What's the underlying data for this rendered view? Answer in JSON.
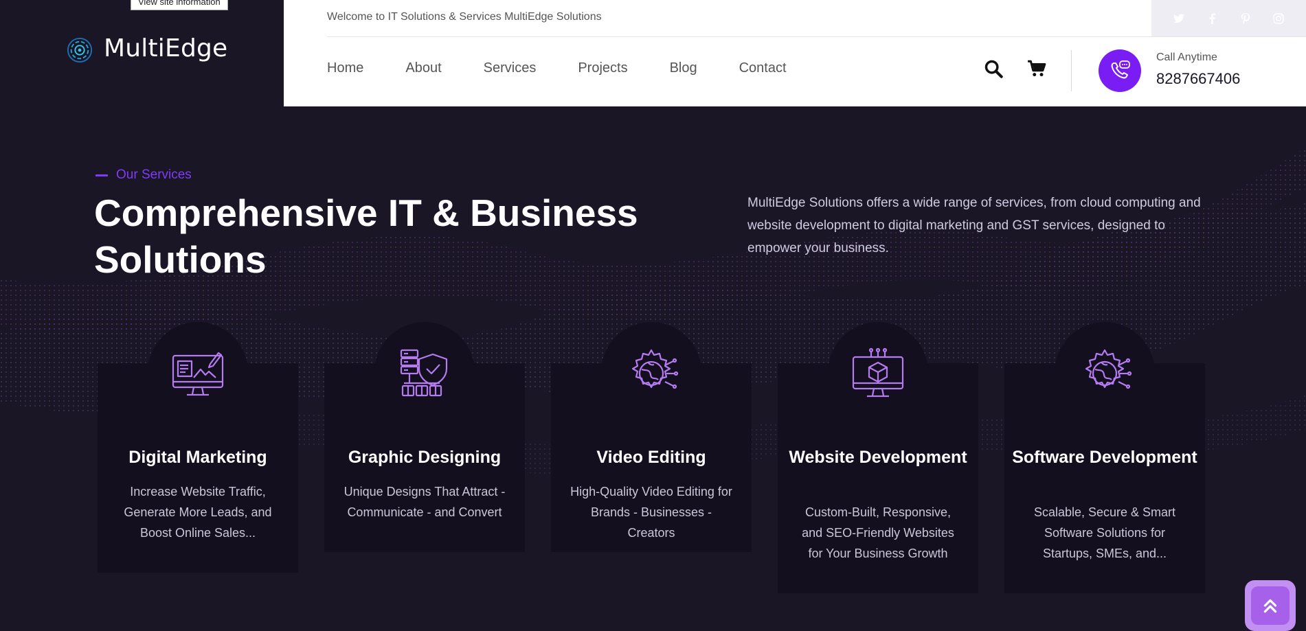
{
  "tooltip": "View site information",
  "brand": {
    "name": "MultiEdge"
  },
  "header": {
    "welcome": "Welcome to IT Solutions & Services MultiEdge Solutions",
    "nav": [
      "Home",
      "About",
      "Services",
      "Projects",
      "Blog",
      "Contact"
    ],
    "call_label": "Call Anytime",
    "call_number": "8287667406",
    "social_icons": [
      "twitter-icon",
      "facebook-icon",
      "pinterest-icon",
      "instagram-icon"
    ]
  },
  "section": {
    "eyebrow": "Our Services",
    "title": "Comprehensive IT & Business Solutions",
    "intro": "MultiEdge Solutions offers a wide range of services, from cloud computing and website development to digital marketing and GST services, designed to empower your business."
  },
  "cards": [
    {
      "title": "Digital Marketing",
      "desc": "Increase Website Traffic, Generate More Leads, and Boost Online Sales...",
      "icon": "monitor-design-icon"
    },
    {
      "title": "Graphic Designing",
      "desc": "Unique Designs That Attract - Communicate - and Convert",
      "icon": "server-shield-icon"
    },
    {
      "title": "Video Editing",
      "desc": "High-Quality Video Editing for Brands - Businesses - Creators",
      "icon": "gear-globe-icon"
    },
    {
      "title": "Website Development",
      "desc": "Custom-Built, Responsive, and SEO-Friendly Websites for Your Business Growth",
      "icon": "monitor-cube-icon"
    },
    {
      "title": "Software Development",
      "desc": "Scalable, Secure & Smart Software Solutions for Startups, SMEs, and...",
      "icon": "gear-globe-icon"
    }
  ],
  "colors": {
    "accent": "#7a1cf4",
    "dark_bg": "#1b1626",
    "card_bg": "#130f1e",
    "icon_purple": "#b47cf0"
  }
}
